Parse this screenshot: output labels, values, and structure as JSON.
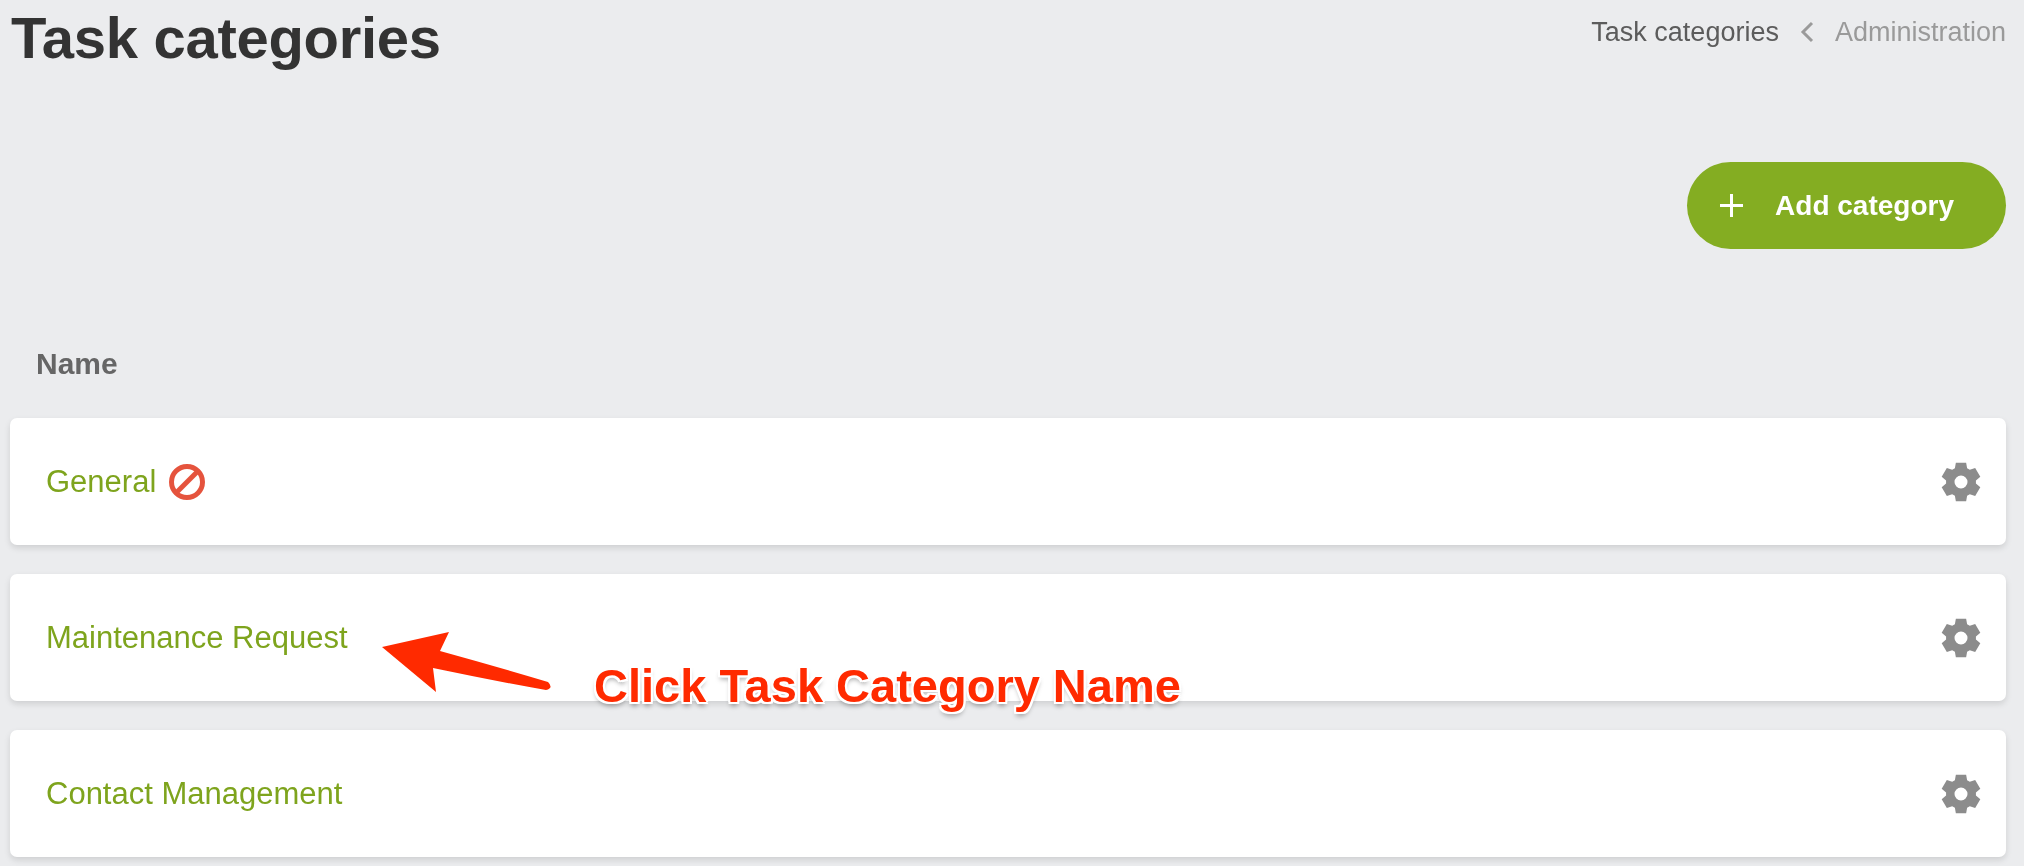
{
  "page": {
    "title": "Task categories"
  },
  "breadcrumb": [
    {
      "label": "Task categories",
      "current": true
    },
    {
      "label": "Administration",
      "current": false
    }
  ],
  "toolbar": {
    "add_button": {
      "label": "Add category"
    }
  },
  "table": {
    "columns": [
      {
        "label": "Name"
      }
    ],
    "rows": [
      {
        "name": "General",
        "restricted": true
      },
      {
        "name": "Maintenance Request",
        "restricted": false
      },
      {
        "name": "Contact Management",
        "restricted": false
      }
    ]
  },
  "annotation": {
    "text": "Click Task Category Name"
  }
}
